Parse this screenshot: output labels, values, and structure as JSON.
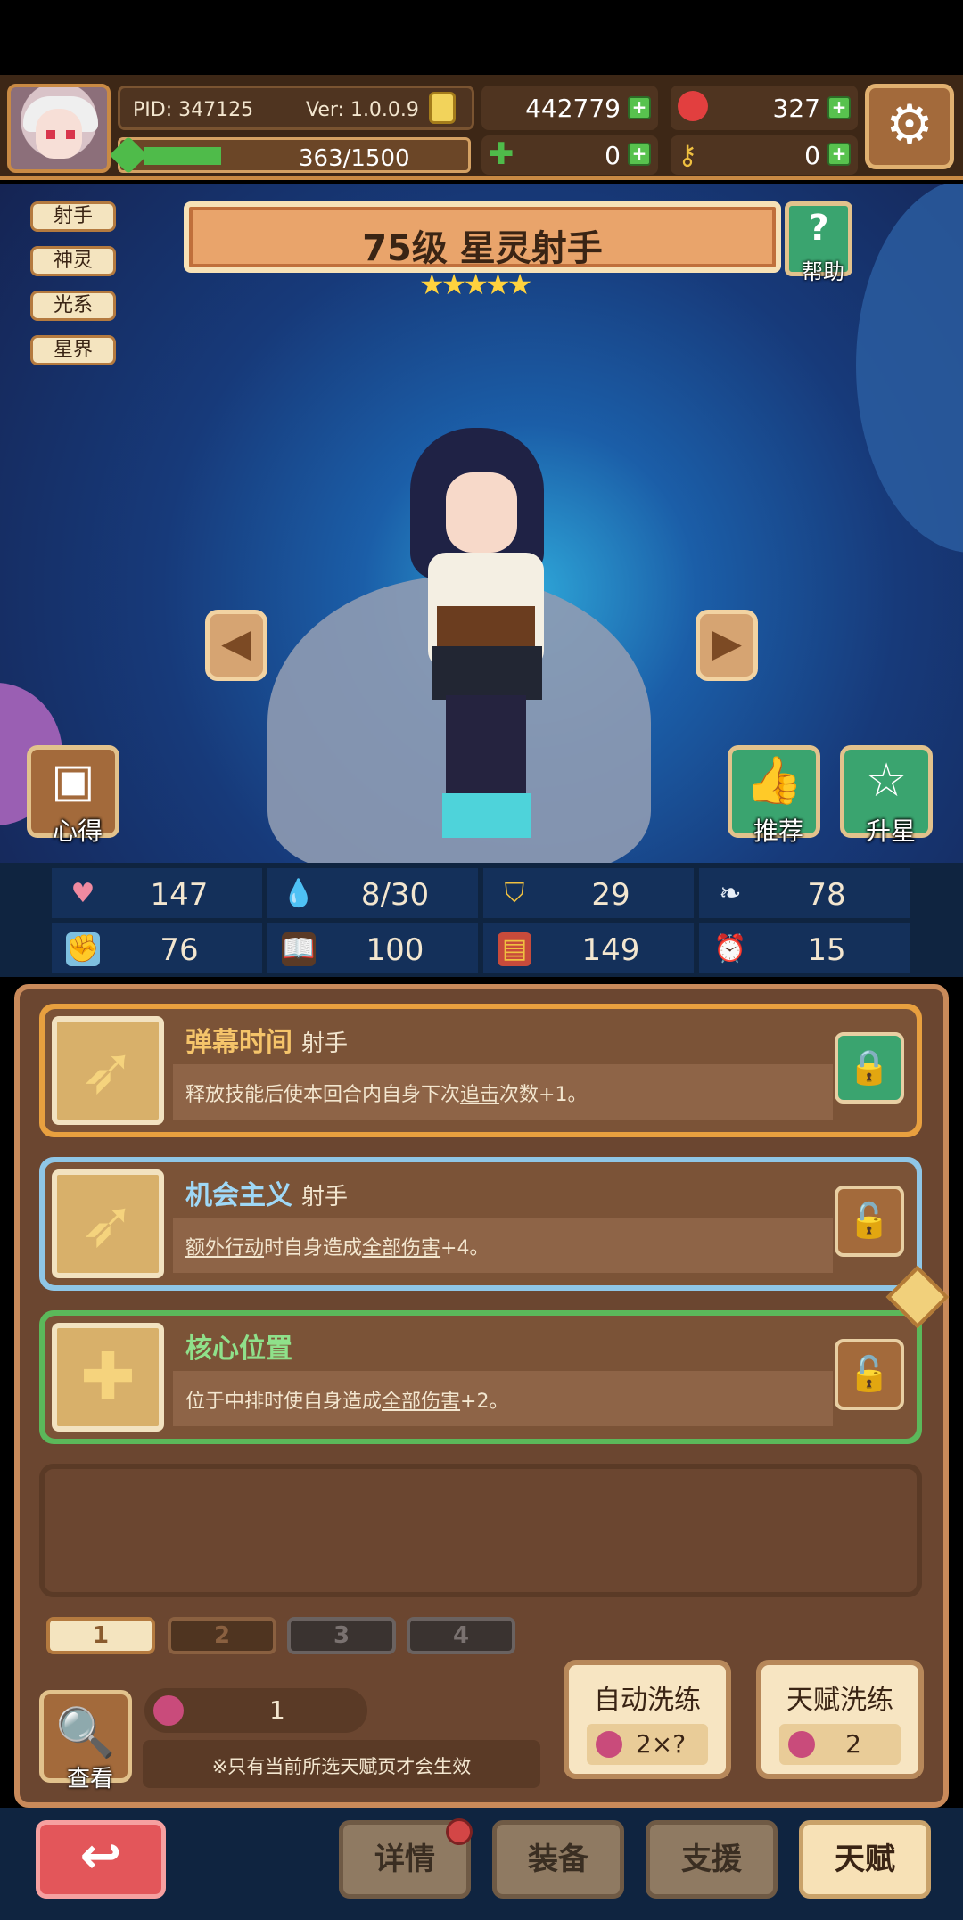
{
  "header": {
    "pid": "PID: 347125",
    "version": "Ver: 1.0.0.9",
    "coins": "442779",
    "gems": "327",
    "clovers": "0",
    "keys": "0",
    "stamina": "363/1500",
    "stamina_fraction": 0.242
  },
  "hero": {
    "title": "75级  星灵射手",
    "stars": "★★★★★",
    "tags": [
      "射手",
      "神灵",
      "光系",
      "星界"
    ],
    "help_label": "帮助",
    "help_icon": "?",
    "left_button_label": "心得",
    "recommend_label": "推荐",
    "upstar_label": "升星"
  },
  "stats": {
    "hp": "147",
    "mana": "8/30",
    "defense": "29",
    "speed": "78",
    "attack": "76",
    "magic": "100",
    "card": "149",
    "crit": "15"
  },
  "talents": [
    {
      "name": "弹幕时间",
      "class": "射手",
      "desc_pre": "释放技能后使本回合内自身下次",
      "desc_link": "追击",
      "desc_post": "次数+1。",
      "icon": "bow-icon",
      "locked": true
    },
    {
      "name": "机会主义",
      "class": "射手",
      "desc_pre": "",
      "desc_link": "额外行动",
      "desc_mid": "时自身造成",
      "desc_link2": "全部伤害",
      "desc_post": "+4。",
      "icon": "bow-icon",
      "locked": false
    },
    {
      "name": "核心位置",
      "class": "",
      "desc_pre": "位于中排时使自身造成",
      "desc_link": "全部伤害",
      "desc_post": "+2。",
      "icon": "cross-icon",
      "locked": false
    }
  ],
  "pages": [
    "1",
    "2",
    "3",
    "4"
  ],
  "footer": {
    "view_label": "查看",
    "fruit_count": "1",
    "note": "※只有当前所选天赋页才会生效",
    "auto_wash_label": "自动洗练",
    "auto_wash_cost": "2×?",
    "talent_wash_label": "天赋洗练",
    "talent_wash_cost": "2"
  },
  "nav": {
    "back_icon": "↩",
    "details": "详情",
    "equip": "装备",
    "support": "支援",
    "talent": "天赋"
  },
  "colors": {
    "green_border": "#5bb85a",
    "blue_border": "#8fc6e6",
    "orange_border": "#e8a03f",
    "active_nav": "#f7e1b6"
  }
}
